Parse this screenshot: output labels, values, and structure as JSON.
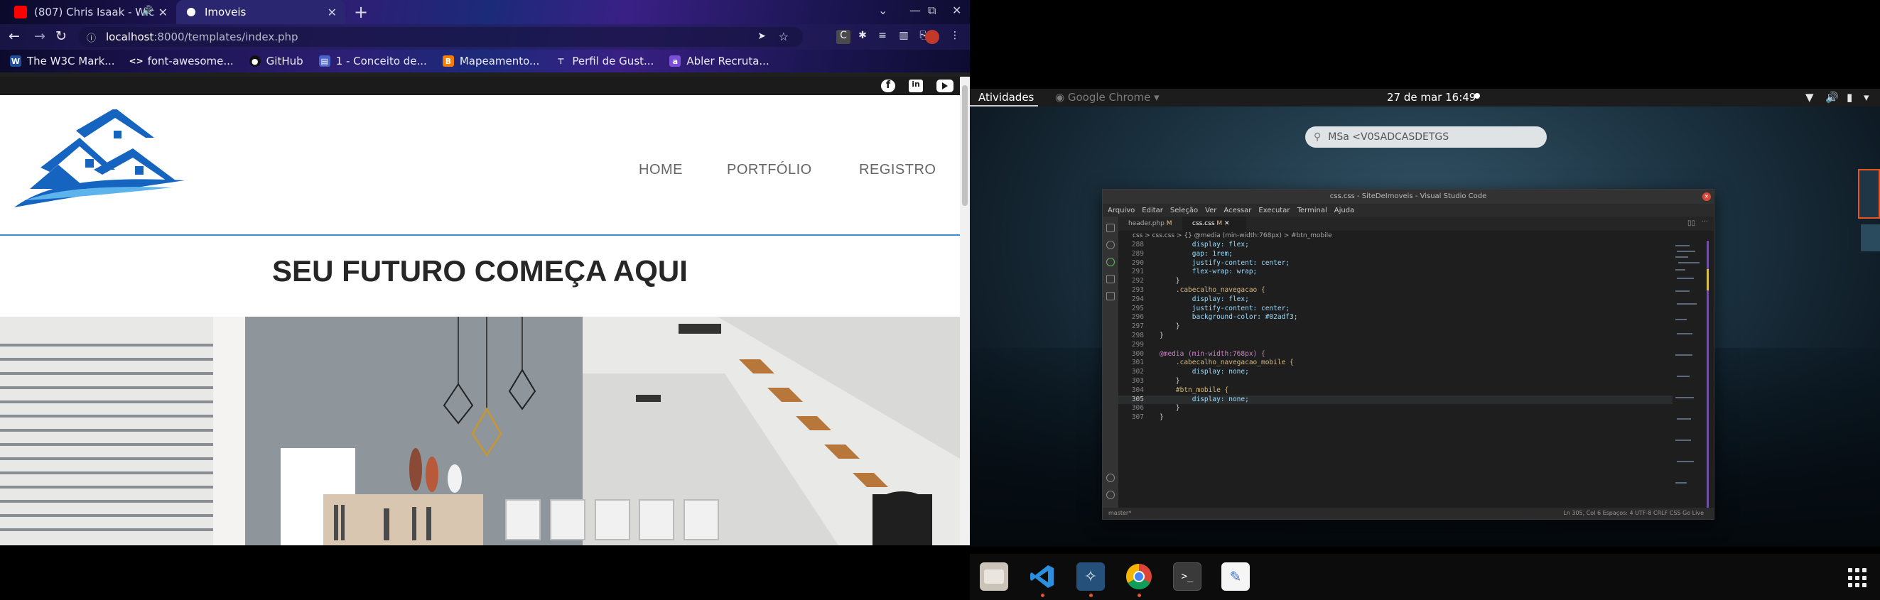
{
  "browser": {
    "tabs": [
      {
        "title": "(807) Chris Isaak - Wic",
        "favicon": "youtube-icon"
      },
      {
        "title": "Imoveis",
        "favicon": "globe-icon"
      }
    ],
    "address": {
      "host": "localhost",
      "path": ":8000/templates/index.php"
    },
    "bookmarks": [
      {
        "label": "The W3C Mark...",
        "icon": "w3c-icon"
      },
      {
        "label": "font-awesome...",
        "icon": "code-icon"
      },
      {
        "label": "GitHub",
        "icon": "github-icon"
      },
      {
        "label": "1 - Conceito de...",
        "icon": "bookmark-icon"
      },
      {
        "label": "Mapeamento...",
        "icon": "blogger-icon"
      },
      {
        "label": "Perfil de Gust...",
        "icon": "pin-icon"
      },
      {
        "label": "Abler Recruta...",
        "icon": "abler-icon"
      }
    ]
  },
  "site": {
    "menu": {
      "home": "HOME",
      "portfolio": "PORTFÓLIO",
      "register": "REGISTRO"
    },
    "hero_title": "SEU FUTURO COMEÇA AQUI",
    "social": [
      "facebook-icon",
      "linkedin-icon",
      "youtube-icon"
    ]
  },
  "gnome": {
    "activities": "Atividades",
    "app_menu": "Google Chrome",
    "clock": "27 de mar  16:49",
    "search_text": "MSa <V0SADCASDETGS"
  },
  "vscode": {
    "title": "css.css - SiteDeImoveis - Visual Studio Code",
    "menu": [
      "Arquivo",
      "Editar",
      "Seleção",
      "Ver",
      "Acessar",
      "Executar",
      "Terminal",
      "Ajuda"
    ],
    "tabs": [
      {
        "name": "header.php",
        "mark": "M"
      },
      {
        "name": "css.css",
        "mark": "M"
      }
    ],
    "breadcrumb": "css > css.css > {} @media (min-width:768px) > #btn_mobile",
    "status_left": "master*",
    "status_right": "Ln 305, Col 6   Espaços: 4   UTF-8   CRLF   CSS   Go Live",
    "code": [
      {
        "n": "288",
        "t": "        display: flex;"
      },
      {
        "n": "289",
        "t": "        gap: 1rem;"
      },
      {
        "n": "290",
        "t": "        justify-content: center;"
      },
      {
        "n": "291",
        "t": "        flex-wrap: wrap;"
      },
      {
        "n": "292",
        "t": "    }"
      },
      {
        "n": "293",
        "t": "    .cabecalho_navegacao {"
      },
      {
        "n": "294",
        "t": "        display: flex;"
      },
      {
        "n": "295",
        "t": "        justify-content: center;"
      },
      {
        "n": "296",
        "t": "        background-color: #02adf3;"
      },
      {
        "n": "297",
        "t": "    }"
      },
      {
        "n": "298",
        "t": "}"
      },
      {
        "n": "299",
        "t": ""
      },
      {
        "n": "300",
        "t": "@media (min-width:768px) {"
      },
      {
        "n": "301",
        "t": "    .cabecalho_navegacao_mobile {"
      },
      {
        "n": "302",
        "t": "        display: none;"
      },
      {
        "n": "303",
        "t": "    }"
      },
      {
        "n": "304",
        "t": "    #btn_mobile {"
      },
      {
        "n": "305",
        "t": "        display: none;"
      },
      {
        "n": "306",
        "t": "    }"
      },
      {
        "n": "307",
        "t": "}"
      }
    ]
  },
  "colors": {
    "accent_vs_status": "#e95420",
    "site_divider": "#3b8fd0",
    "logo_blue": "#1565c0"
  }
}
